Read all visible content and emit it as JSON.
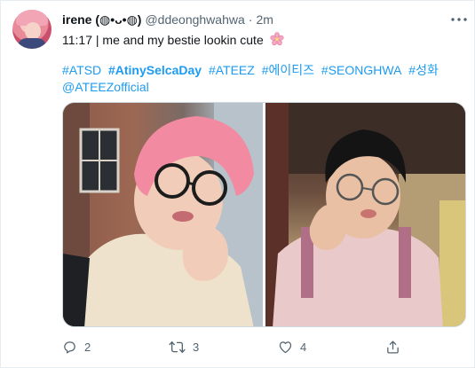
{
  "user": {
    "display_name": "irene (◍•ᴗ•◍)",
    "handle": "@ddeonghwahwa",
    "separator": "·",
    "time": "2m"
  },
  "tweet": {
    "text": "11:17 | me and my bestie lookin cute",
    "emoji_icon": "cherry-blossom-icon",
    "hashtags": [
      "#ATSD",
      "#AtinySelcaDay",
      "#ATEEZ",
      "#에이티즈",
      "#SEONGHWA",
      "#성화"
    ],
    "mention": "@ATEEZofficial"
  },
  "actions": {
    "reply_count": "2",
    "retweet_count": "3",
    "like_count": "4"
  },
  "colors": {
    "link": "#1d9bf0",
    "secondary_text": "#536471",
    "primary_text": "#0f1419"
  }
}
